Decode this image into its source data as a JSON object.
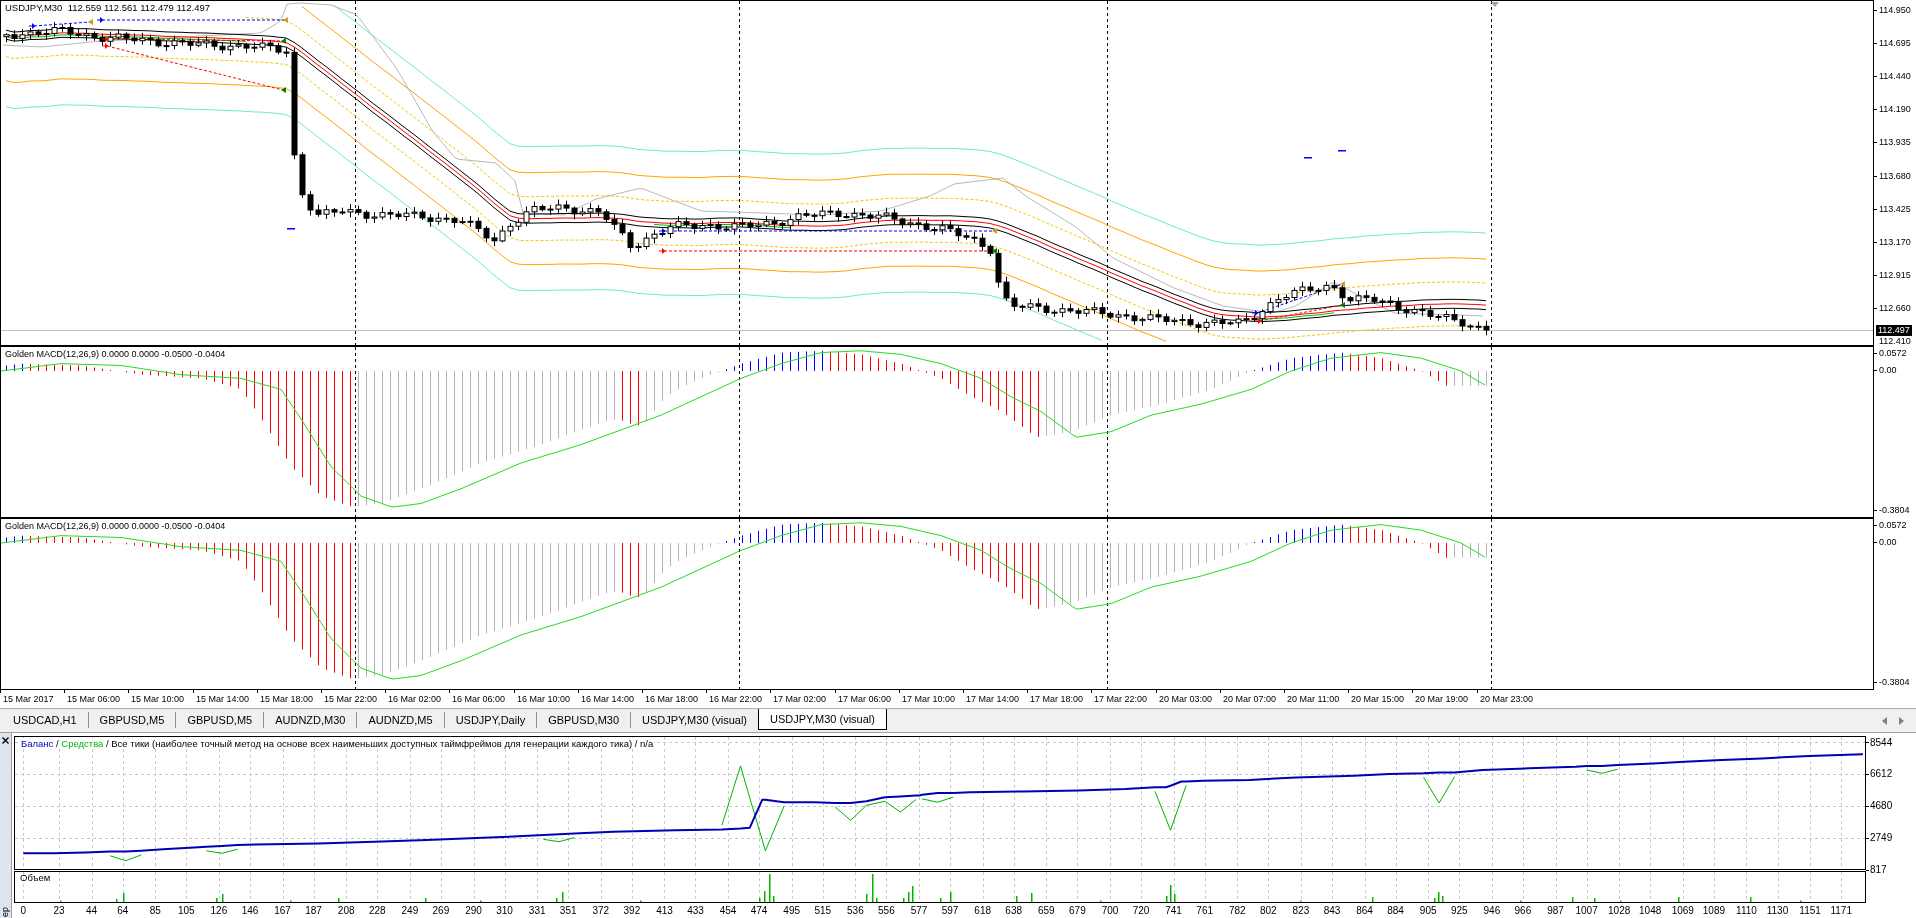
{
  "chart": {
    "symbol": "USDJPY,M30",
    "ohlc": [
      "112.559",
      "112.561",
      "112.479",
      "112.497"
    ],
    "price_axis": [
      "114.950",
      "114.695",
      "114.440",
      "114.190",
      "113.935",
      "113.680",
      "113.425",
      "113.170",
      "112.915",
      "112.660"
    ],
    "current_price": "112.497",
    "bottom_price": "112.410"
  },
  "indicators": [
    {
      "title": "Golden MACD(12,26,9) 0.0000 0.0000 -0.0500 -0.0404",
      "axis": [
        "0.0572",
        "0.00",
        "-0.3804"
      ]
    },
    {
      "title": "Golden MACD(12,26,9) 0.0000 0.0000 -0.0500 -0.0404",
      "axis": [
        "0.0572",
        "0.00",
        "-0.3804"
      ]
    }
  ],
  "time_axis": [
    "15 Mar 2017",
    "15 Mar 06:00",
    "15 Mar 10:00",
    "15 Mar 14:00",
    "15 Mar 18:00",
    "15 Mar 22:00",
    "16 Mar 02:00",
    "16 Mar 06:00",
    "16 Mar 10:00",
    "16 Mar 14:00",
    "16 Mar 18:00",
    "16 Mar 22:00",
    "17 Mar 02:00",
    "17 Mar 06:00",
    "17 Mar 10:00",
    "17 Mar 14:00",
    "17 Mar 18:00",
    "17 Mar 22:00",
    "20 Mar 03:00",
    "20 Mar 07:00",
    "20 Mar 11:00",
    "20 Mar 15:00",
    "20 Mar 19:00",
    "20 Mar 23:00"
  ],
  "tabs": [
    {
      "label": "USDCAD,H1",
      "selected": false
    },
    {
      "label": "GBPUSD,M5",
      "selected": false
    },
    {
      "label": "GBPUSD,M5",
      "selected": false
    },
    {
      "label": "AUDNZD,M30",
      "selected": false
    },
    {
      "label": "AUDNZD,M5",
      "selected": false
    },
    {
      "label": "USDJPY,Daily",
      "selected": false
    },
    {
      "label": "GBPUSD,M30",
      "selected": false
    },
    {
      "label": "USDJPY,M30 (visual)",
      "selected": false
    },
    {
      "label": "USDJPY,M30 (visual)",
      "selected": true
    }
  ],
  "tester": {
    "chart_data": {
      "type": "line",
      "x": [
        0,
        20,
        40,
        56,
        66,
        76,
        90,
        110,
        118,
        128,
        138,
        160,
        190,
        226,
        260,
        300,
        335,
        345,
        355,
        380,
        420,
        450,
        462,
        468,
        476,
        478,
        490,
        510,
        523,
        533,
        543,
        555,
        565,
        575,
        577,
        579,
        589,
        599,
        610,
        644,
        680,
        710,
        729,
        736,
        739,
        746,
        749,
        760,
        790,
        820,
        857,
        880,
        902,
        912,
        922,
        940,
        970,
        1000,
        1007,
        1017,
        1027,
        1050,
        1070,
        1094,
        1120,
        1150,
        1170,
        1185
      ],
      "series": [
        {
          "name": "Баланс",
          "color": "#0000b4",
          "values": [
            1800,
            1800,
            1850,
            1900,
            1900,
            1950,
            2050,
            2150,
            2200,
            2250,
            2300,
            2350,
            2400,
            2500,
            2600,
            2750,
            2900,
            2950,
            3000,
            3100,
            3200,
            3250,
            3300,
            3350,
            5050,
            5050,
            4900,
            4900,
            4850,
            4850,
            4950,
            5200,
            5250,
            5300,
            5300,
            5350,
            5450,
            5450,
            5500,
            5550,
            5600,
            5700,
            5800,
            5800,
            5900,
            6150,
            6150,
            6200,
            6250,
            6400,
            6500,
            6600,
            6650,
            6700,
            6700,
            6850,
            6950,
            7050,
            7100,
            7100,
            7150,
            7250,
            7350,
            7450,
            7550,
            7700,
            7750,
            7800
          ]
        },
        {
          "name": "Средства",
          "color": "#00b400",
          "values": [
            null,
            null,
            null,
            1650,
            1350,
            1700,
            null,
            null,
            1950,
            1800,
            2050,
            null,
            null,
            null,
            null,
            null,
            2650,
            2500,
            2750,
            null,
            null,
            3500,
            7100,
            5150,
            2600,
            1950,
            4650,
            null,
            4600,
            3800,
            4700,
            4950,
            4300,
            5050,
            null,
            5100,
            4900,
            5200,
            null,
            null,
            null,
            null,
            5550,
            3900,
            3200,
            5100,
            5900,
            null,
            null,
            null,
            null,
            null,
            6400,
            4850,
            6450,
            null,
            null,
            null,
            6850,
            6650,
            6900,
            null,
            null,
            null,
            null,
            null,
            null,
            null
          ]
        }
      ],
      "xticks": [
        0,
        23,
        44,
        64,
        85,
        105,
        126,
        146,
        167,
        187,
        208,
        228,
        249,
        269,
        290,
        310,
        331,
        351,
        372,
        392,
        413,
        433,
        454,
        474,
        495,
        515,
        536,
        556,
        577,
        597,
        618,
        638,
        659,
        679,
        700,
        720,
        741,
        761,
        782,
        802,
        823,
        843,
        864,
        884,
        905,
        925,
        946,
        966,
        987,
        1007,
        1028,
        1048,
        1069,
        1089,
        1110,
        1130,
        1151,
        1171
      ],
      "yticks": [
        817,
        2749,
        4680,
        6612,
        8544
      ],
      "xlim": [
        -6,
        1187
      ],
      "ylim": [
        817,
        8880
      ],
      "grid": true
    },
    "separators": [
      "/",
      "/",
      "/"
    ],
    "model": "Все тики (наиболее точный метод на основе всех наименьших доступных таймфреймов для генерации каждого тика)",
    "period": "n/a",
    "volume_label": "Объем",
    "side_tab": "ер"
  }
}
